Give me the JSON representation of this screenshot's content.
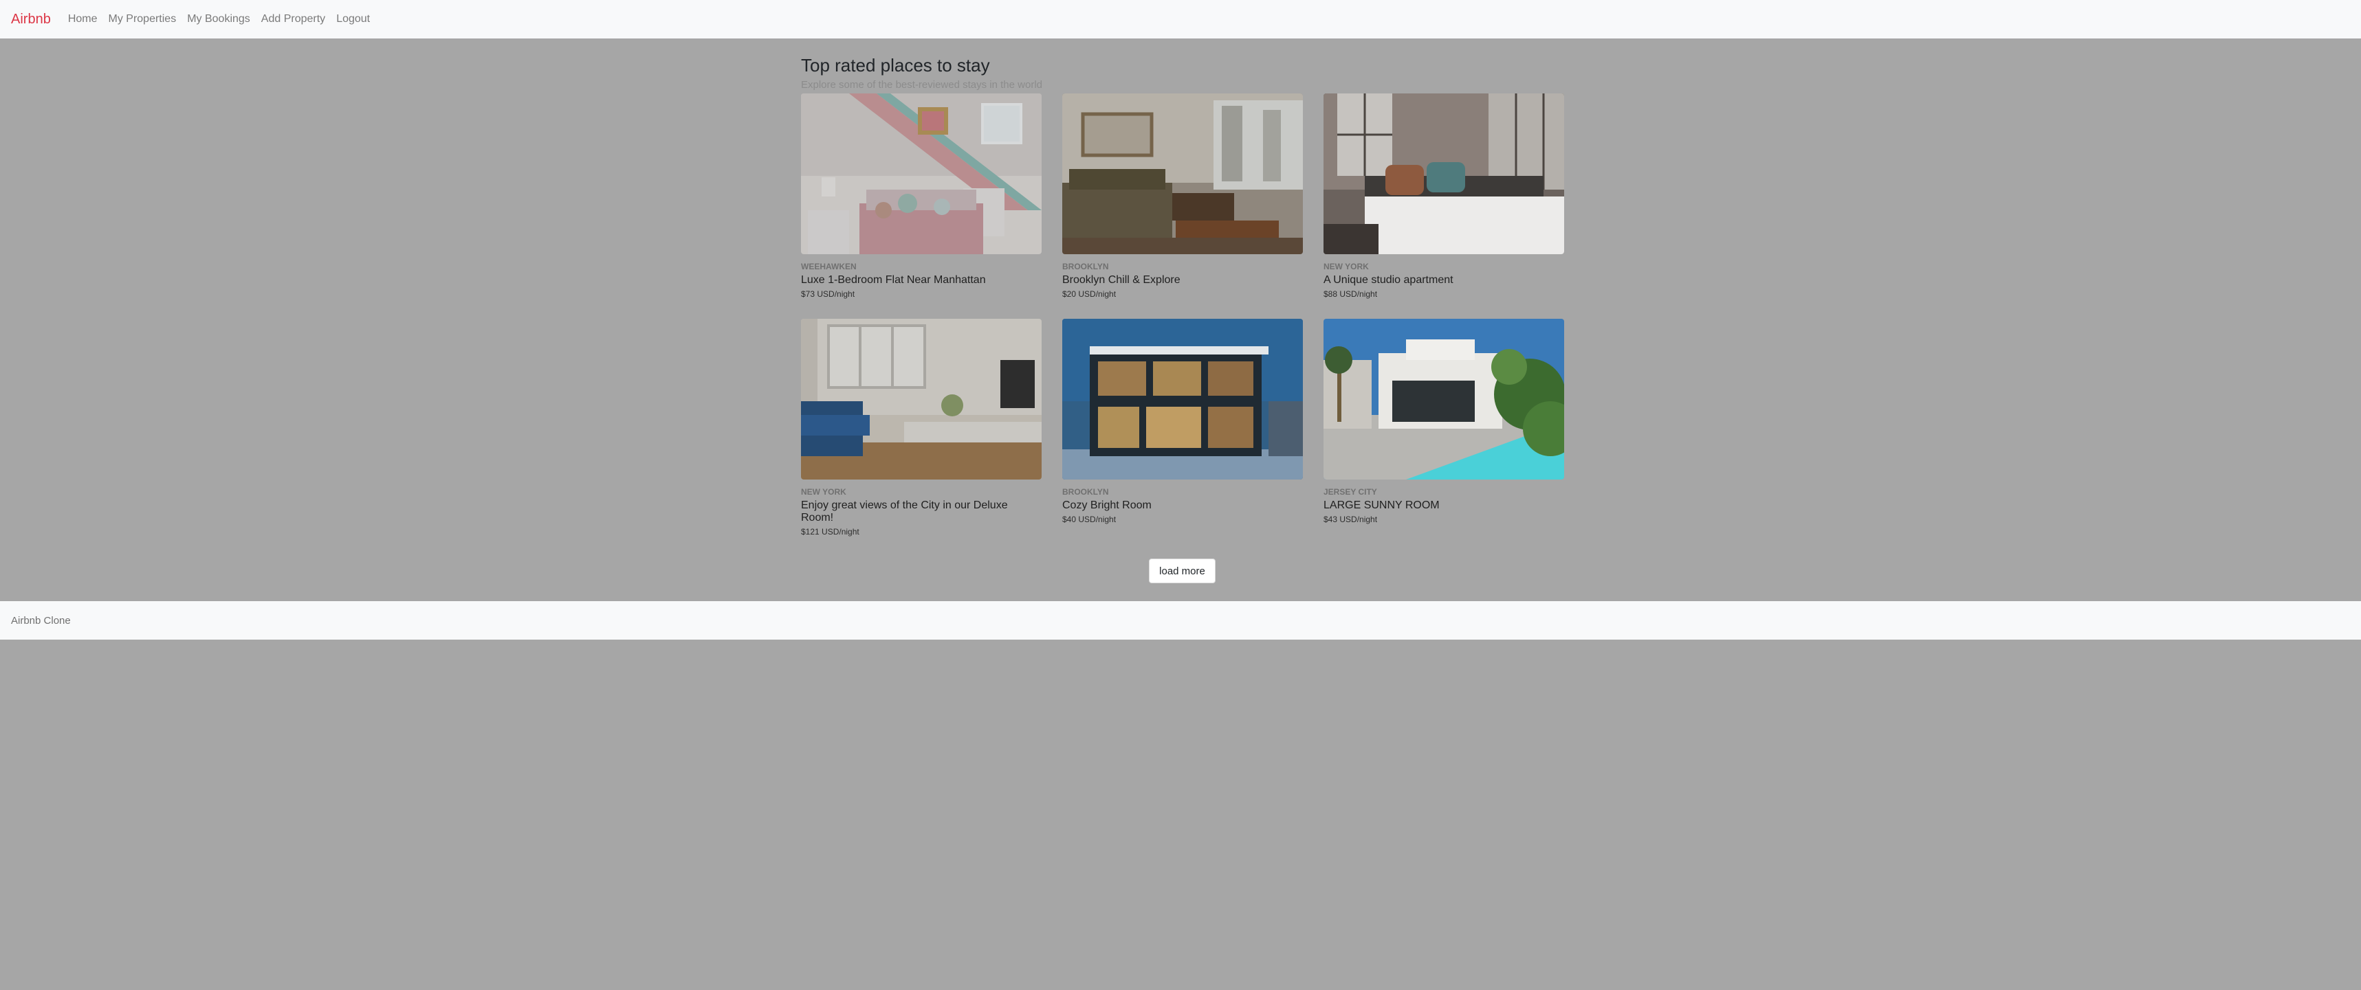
{
  "navbar": {
    "brand": "Airbnb",
    "links": [
      "Home",
      "My Properties",
      "My Bookings",
      "Add Property",
      "Logout"
    ]
  },
  "hero": {
    "title": "Top rated places to stay",
    "subtitle": "Explore some of the best-reviewed stays in the world"
  },
  "listings": [
    {
      "city": "WEEHAWKEN",
      "title": "Luxe 1-Bedroom Flat Near Manhattan",
      "price": "$73 USD/night",
      "photo_icon": "bedroom-photo"
    },
    {
      "city": "BROOKLYN",
      "title": "Brooklyn Chill & Explore",
      "price": "$20 USD/night",
      "photo_icon": "living-room-photo"
    },
    {
      "city": "NEW YORK",
      "title": "A Unique studio apartment",
      "price": "$88 USD/night",
      "photo_icon": "loft-bedroom-photo"
    },
    {
      "city": "NEW YORK",
      "title": "Enjoy great views of the City in our Deluxe Room!",
      "price": "$121 USD/night",
      "photo_icon": "deluxe-room-photo"
    },
    {
      "city": "BROOKLYN",
      "title": "Cozy Bright Room",
      "price": "$40 USD/night",
      "photo_icon": "modern-house-photo"
    },
    {
      "city": "JERSEY CITY",
      "title": "LARGE SUNNY ROOM",
      "price": "$43 USD/night",
      "photo_icon": "villa-pool-photo"
    }
  ],
  "load_more_label": "load more",
  "footer": {
    "text": "Airbnb Clone"
  },
  "colors": {
    "brand": "#dc3545",
    "overlay_background": "#a6a6a6",
    "bar_background": "#f8f9fa"
  }
}
